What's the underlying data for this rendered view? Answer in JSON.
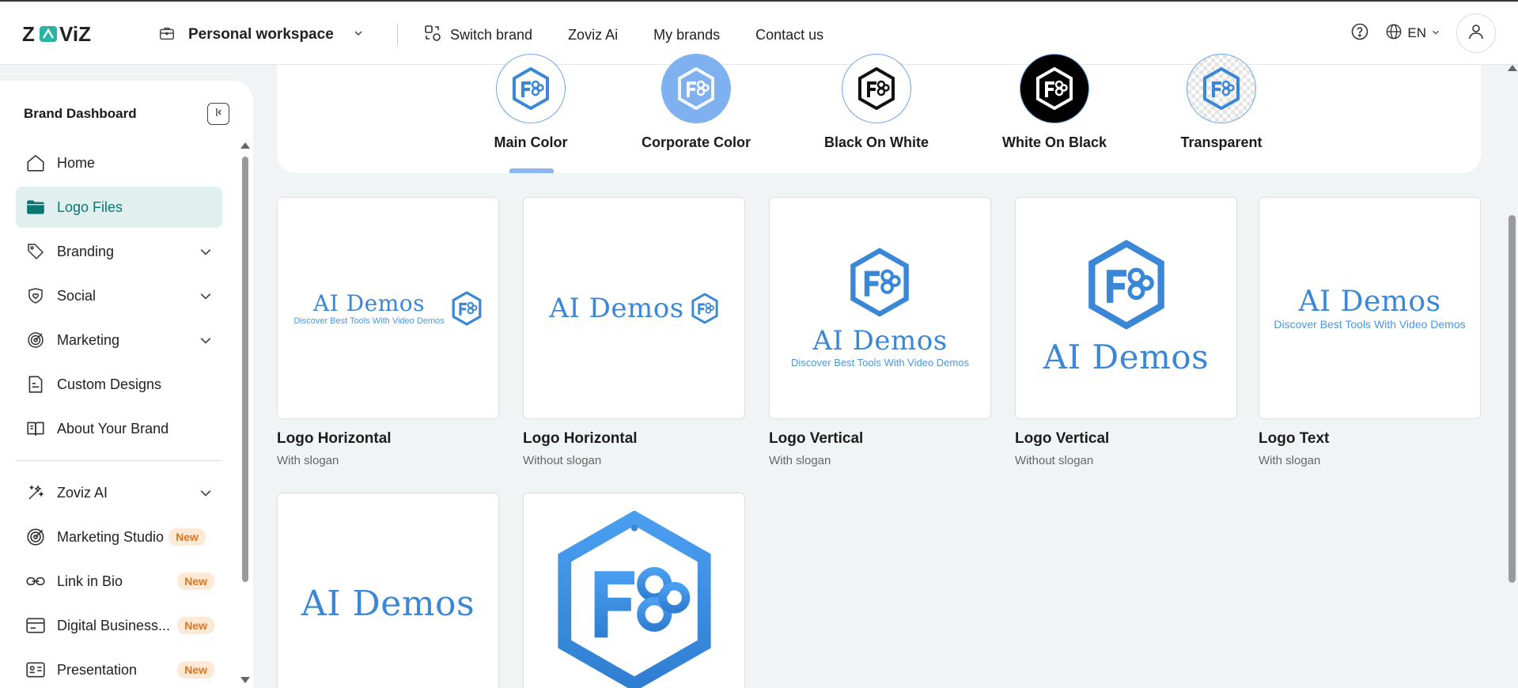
{
  "header": {
    "brand": "ZOVIZ",
    "workspace": "Personal workspace",
    "nav": [
      "Switch brand",
      "Zoviz Ai",
      "My brands",
      "Contact us"
    ],
    "language": "EN"
  },
  "sidebar": {
    "title": "Brand Dashboard",
    "items": [
      {
        "label": "Home",
        "icon": "home-icon"
      },
      {
        "label": "Logo Files",
        "icon": "folder-icon",
        "active": true
      },
      {
        "label": "Branding",
        "icon": "tag-icon",
        "expandable": true
      },
      {
        "label": "Social",
        "icon": "heart-shield-icon",
        "expandable": true
      },
      {
        "label": "Marketing",
        "icon": "target-icon",
        "expandable": true
      },
      {
        "label": "Custom Designs",
        "icon": "document-icon"
      },
      {
        "label": "About Your Brand",
        "icon": "book-icon"
      }
    ],
    "ai_items": [
      {
        "label": "Zoviz AI",
        "icon": "magic-wand-icon",
        "expandable": true
      },
      {
        "label": "Marketing Studio",
        "icon": "target-icon",
        "badge": "New"
      },
      {
        "label": "Link in Bio",
        "icon": "link-icon",
        "badge": "New"
      },
      {
        "label": "Digital Business...",
        "icon": "card-icon",
        "badge": "New"
      },
      {
        "label": "Presentation",
        "icon": "presentation-icon",
        "badge": "New"
      }
    ]
  },
  "styles": [
    {
      "label": "Main Color"
    },
    {
      "label": "Corporate Color"
    },
    {
      "label": "Black On White"
    },
    {
      "label": "White On Black"
    },
    {
      "label": "Transparent"
    }
  ],
  "logo_cards": [
    {
      "title": "Logo Horizontal",
      "subtitle": "With slogan"
    },
    {
      "title": "Logo Horizontal",
      "subtitle": "Without slogan"
    },
    {
      "title": "Logo Vertical",
      "subtitle": "With slogan"
    },
    {
      "title": "Logo Vertical",
      "subtitle": "Without slogan"
    },
    {
      "title": "Logo Text",
      "subtitle": "With slogan"
    },
    {
      "title": "",
      "subtitle": ""
    },
    {
      "title": "",
      "subtitle": ""
    }
  ],
  "logo_text": {
    "name": "AI Demos",
    "slogan": "Discover Best Tools With Video Demos"
  },
  "colors": {
    "accent": "#0b7772",
    "active_bg": "#dff0ef",
    "logo_blue": "#3a87d8",
    "badge_text": "#e0751c",
    "badge_bg": "#fde9d6"
  }
}
